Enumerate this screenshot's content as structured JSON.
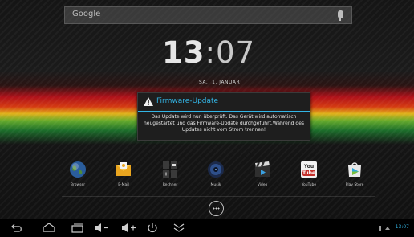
{
  "search": {
    "placeholder": "Google"
  },
  "clock": {
    "hours": "13",
    "separator": ":",
    "minutes": "07"
  },
  "date": "SA., 1. JANUAR",
  "dialog": {
    "title": "Firmware-Update",
    "message": "Das Update wird nun überprüft. Das Gerät wird automatisch neugestartet und das Firmware-Update durchgeführt.Während des Updates nicht vom Strom trennen!"
  },
  "apps": [
    {
      "label": "Browser",
      "icon": "globe-icon"
    },
    {
      "label": "E-Mail",
      "icon": "email-icon"
    },
    {
      "label": "Rechner",
      "icon": "calculator-icon"
    },
    {
      "label": "Musik",
      "icon": "music-icon"
    },
    {
      "label": "Video",
      "icon": "video-icon"
    },
    {
      "label": "YouTube",
      "icon": "youtube-icon"
    },
    {
      "label": "Play Store",
      "icon": "play-store-icon"
    }
  ],
  "youtube_badge": {
    "top": "You",
    "bottom": "Tube"
  },
  "navbar": {
    "buttons": [
      "back-icon",
      "home-icon",
      "recent-apps-icon",
      "volume-down-icon",
      "volume-up-icon",
      "power-icon",
      "menu-collapse-icon"
    ],
    "time": "13:07"
  },
  "colors": {
    "accent": "#33b5e5",
    "dialog_bg": "#1e1e1e"
  }
}
